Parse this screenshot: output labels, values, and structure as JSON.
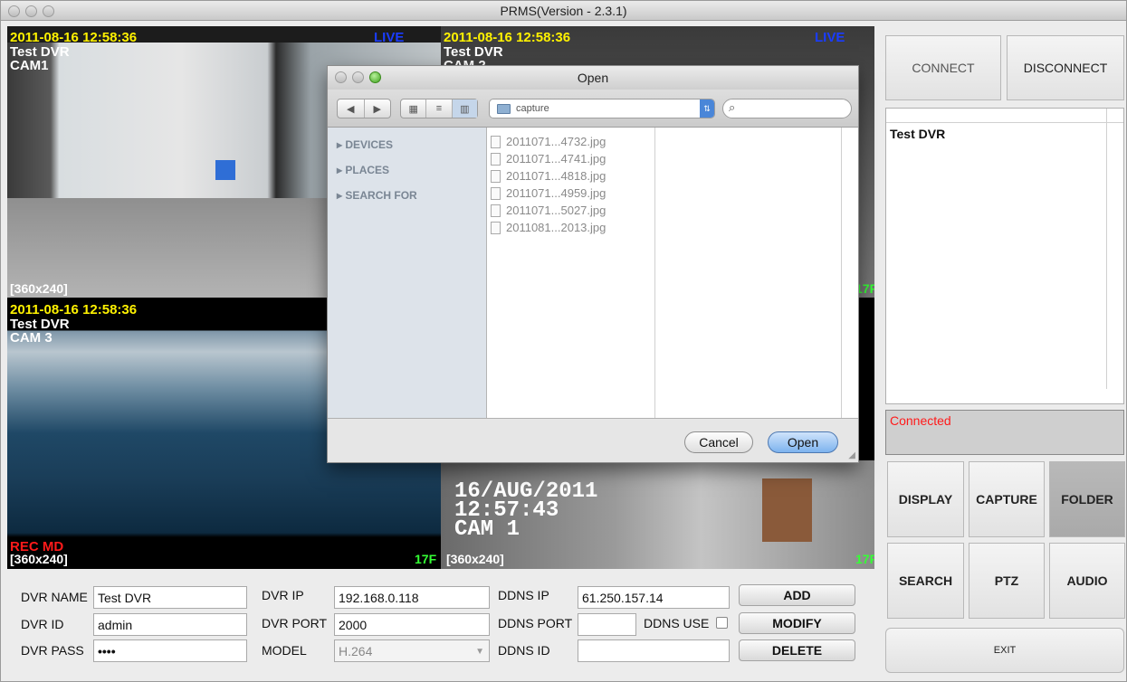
{
  "window": {
    "title": "PRMS(Version - 2.3.1)"
  },
  "cameras": {
    "cam1": {
      "timestamp": "2011-08-16 12:58:36",
      "dvr": "Test DVR",
      "cam": "CAM1",
      "mode": "LIVE",
      "res": "[360x240]"
    },
    "cam2": {
      "timestamp": "2011-08-16 12:58:36",
      "dvr": "Test DVR",
      "cam": "CAM 2",
      "mode": "LIVE",
      "fps": "17F"
    },
    "cam3": {
      "timestamp": "2011-08-16 12:58:36",
      "dvr": "Test DVR",
      "cam": "CAM 3",
      "rec": "REC MD",
      "res": "[360x240]",
      "fps": "17F"
    },
    "cam4": {
      "osd_date": "16/AUG/2011",
      "osd_time": "12:57:43",
      "osd_cam": "CAM 1",
      "res": "[360x240]",
      "fps": "17F"
    }
  },
  "right_panel": {
    "connect": "CONNECT",
    "disconnect": "DISCONNECT",
    "dvr_list": [
      "Test DVR"
    ],
    "status": "Connected",
    "display": "DISPLAY",
    "capture": "CAPTURE",
    "folder": "FOLDER",
    "search": "SEARCH",
    "ptz": "PTZ",
    "audio": "AUDIO",
    "exit": "EXIT"
  },
  "form": {
    "dvr_name_label": "DVR NAME",
    "dvr_name": "Test DVR",
    "dvr_id_label": "DVR ID",
    "dvr_id": "admin",
    "dvr_pass_label": "DVR PASS",
    "dvr_pass": "••••",
    "dvr_ip_label": "DVR IP",
    "dvr_ip": "192.168.0.118",
    "dvr_port_label": "DVR PORT",
    "dvr_port": "2000",
    "model_label": "MODEL",
    "model": "H.264",
    "ddns_ip_label": "DDNS IP",
    "ddns_ip": "61.250.157.14",
    "ddns_port_label": "DDNS PORT",
    "ddns_port": "",
    "ddns_use_label": "DDNS USE",
    "ddns_id_label": "DDNS ID",
    "ddns_id": "",
    "add": "ADD",
    "modify": "MODIFY",
    "delete": "DELETE"
  },
  "dialog": {
    "title": "Open",
    "location": "capture",
    "search_placeholder": "",
    "sidebar": [
      "DEVICES",
      "PLACES",
      "SEARCH FOR"
    ],
    "files": [
      "2011071...4732.jpg",
      "2011071...4741.jpg",
      "2011071...4818.jpg",
      "2011071...4959.jpg",
      "2011071...5027.jpg",
      "2011081...2013.jpg"
    ],
    "cancel": "Cancel",
    "open": "Open"
  }
}
